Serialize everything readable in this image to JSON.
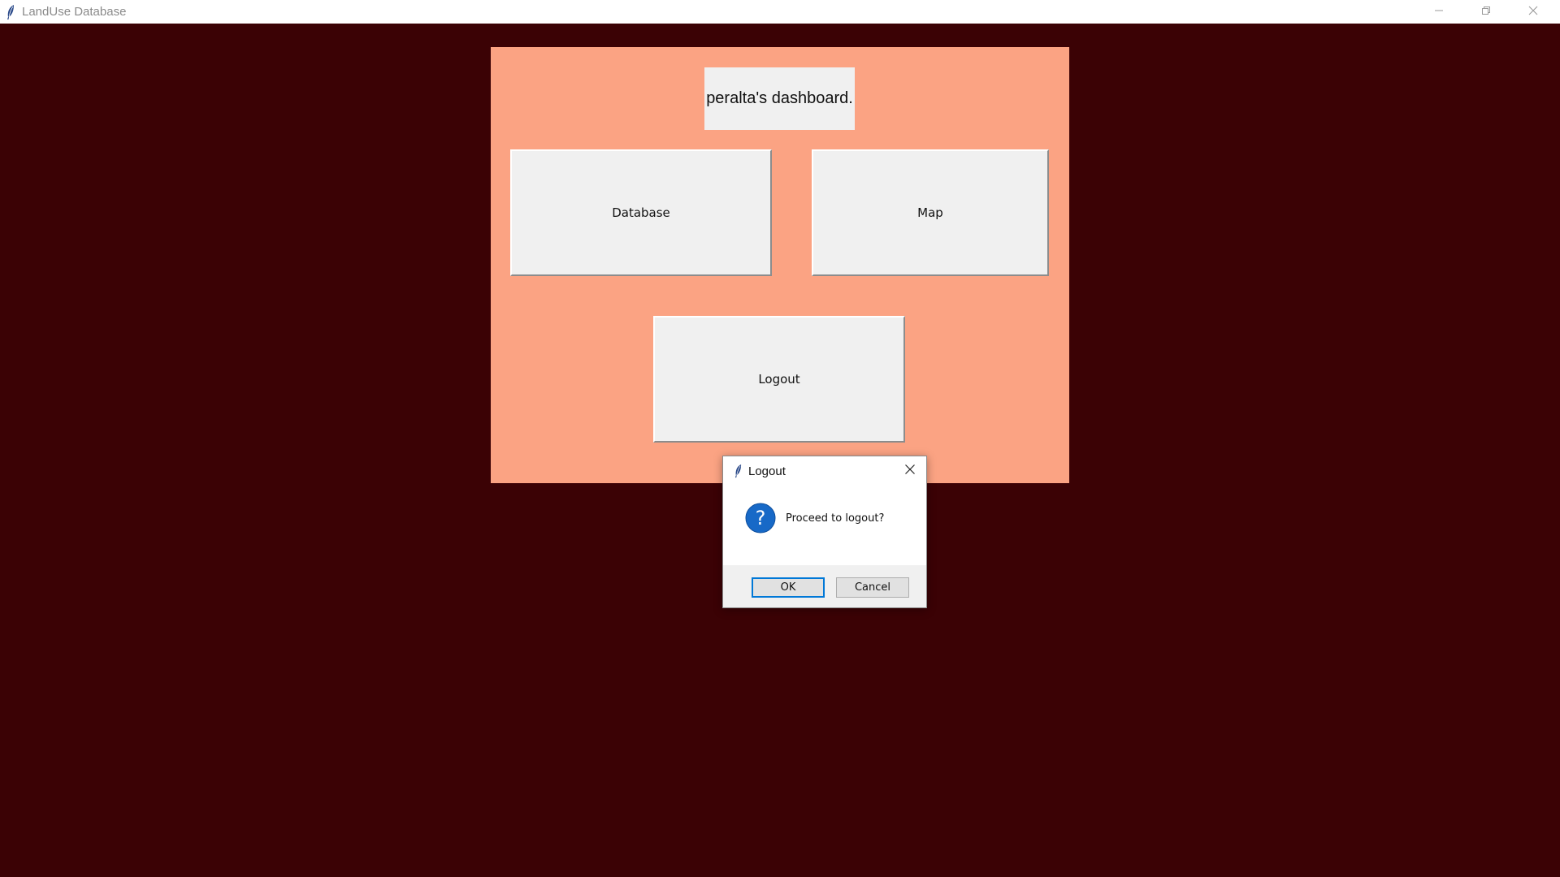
{
  "window": {
    "title": "LandUse Database",
    "app_icon": "feather-icon",
    "controls": [
      "minimize-icon",
      "restore-icon",
      "close-icon"
    ]
  },
  "colors": {
    "background": "#3b0205",
    "panel": "#fba383",
    "button_face": "#f0f0f0",
    "dialog_default_border": "#0078d7",
    "question_icon": "#1769c7"
  },
  "dashboard": {
    "label": "peralta's dashboard.",
    "buttons": {
      "database": "Database",
      "map": "Map",
      "logout": "Logout"
    }
  },
  "dialog": {
    "title": "Logout",
    "icon": "question-icon",
    "message": "Proceed to logout?",
    "ok_label": "OK",
    "cancel_label": "Cancel"
  }
}
